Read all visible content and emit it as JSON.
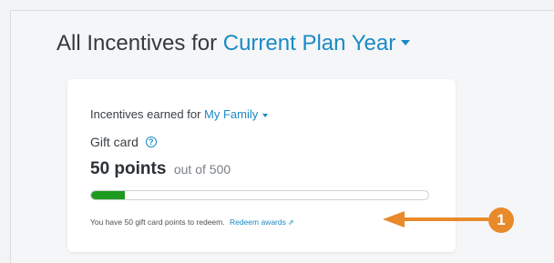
{
  "header": {
    "title_prefix": "All Incentives for",
    "plan_year": "Current Plan Year"
  },
  "card": {
    "earned_label": "Incentives earned for",
    "family_selector": "My Family",
    "gift_card_label": "Gift card",
    "points_value": "50 points",
    "points_total_text": "out of 500",
    "progress": {
      "current": 50,
      "max": 500
    },
    "redeem_text": "You have 50 gift card points to redeem.",
    "redeem_link": "Redeem awards"
  },
  "annotation": {
    "callout_number": "1",
    "callout_color": "#e8892a"
  },
  "colors": {
    "accent": "#1a8ac6",
    "progress": "#1e9a1e"
  },
  "icons": {
    "info": "info-circle-icon",
    "external": "external-link-icon",
    "dropdown": "chevron-down-icon"
  }
}
